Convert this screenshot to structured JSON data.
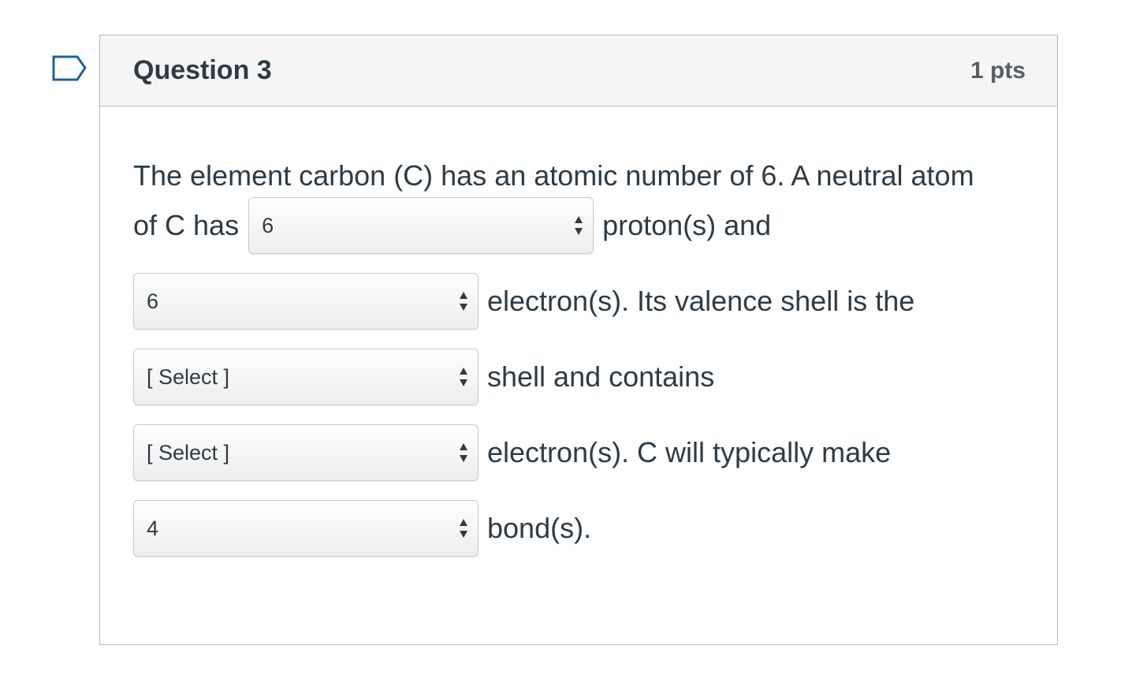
{
  "question": {
    "title": "Question 3",
    "points": "1 pts",
    "text": {
      "intro_line": "The element carbon (C) has an atomic number of 6. A neutral atom",
      "prefix_protons": "of C has",
      "after_protons": "proton(s) and",
      "after_electrons": "electron(s). Its valence shell is the",
      "after_shell": "shell and contains",
      "after_valence": "electron(s). C will typically make",
      "after_bonds": "bond(s)."
    },
    "dropdowns": {
      "protons": "6",
      "electrons": "6",
      "valence_shell": "[ Select ]",
      "valence_electrons": "[ Select ]",
      "bonds": "4"
    }
  },
  "icons": {
    "flag": "flag-outline-icon",
    "caret": "sort-caret-icon"
  },
  "colors": {
    "header_bg": "#f5f5f5",
    "border": "#b5b9bd",
    "text": "#2d3b45",
    "flag_stroke": "#1f5f8b"
  }
}
